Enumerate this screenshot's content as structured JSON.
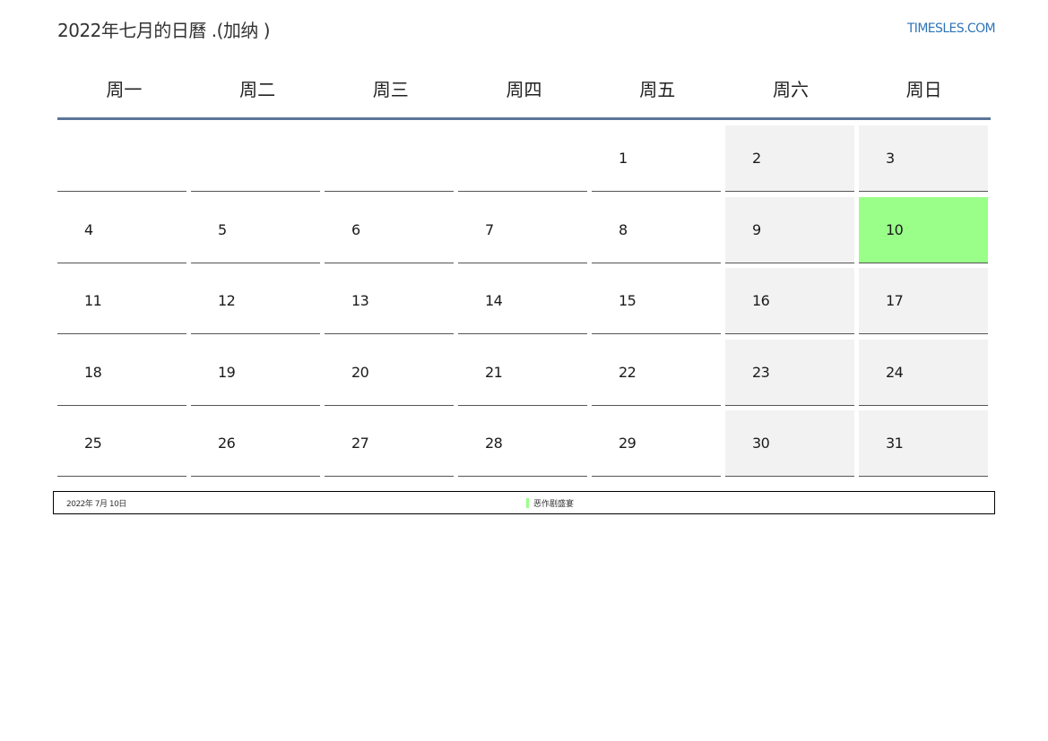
{
  "header": {
    "title": "2022年七月的日曆 .(加纳 )",
    "site": "TIMESLES.COM"
  },
  "weekdays": [
    "周一",
    "周二",
    "周三",
    "周四",
    "周五",
    "周六",
    "周日"
  ],
  "calendar": {
    "weeks": [
      [
        "",
        "",
        "",
        "",
        "1",
        "2",
        "3"
      ],
      [
        "4",
        "5",
        "6",
        "7",
        "8",
        "9",
        "10"
      ],
      [
        "11",
        "12",
        "13",
        "14",
        "15",
        "16",
        "17"
      ],
      [
        "18",
        "19",
        "20",
        "21",
        "22",
        "23",
        "24"
      ],
      [
        "25",
        "26",
        "27",
        "28",
        "29",
        "30",
        "31"
      ]
    ],
    "highlight_day": "10",
    "highlight_color": "#99ff88",
    "weekend_color": "#f2f2f2",
    "rule_color": "#5b7599"
  },
  "footer": {
    "date": "2022年 7月 10日",
    "legend_label": "恶作剧盛宴",
    "legend_color": "#99ff88"
  }
}
